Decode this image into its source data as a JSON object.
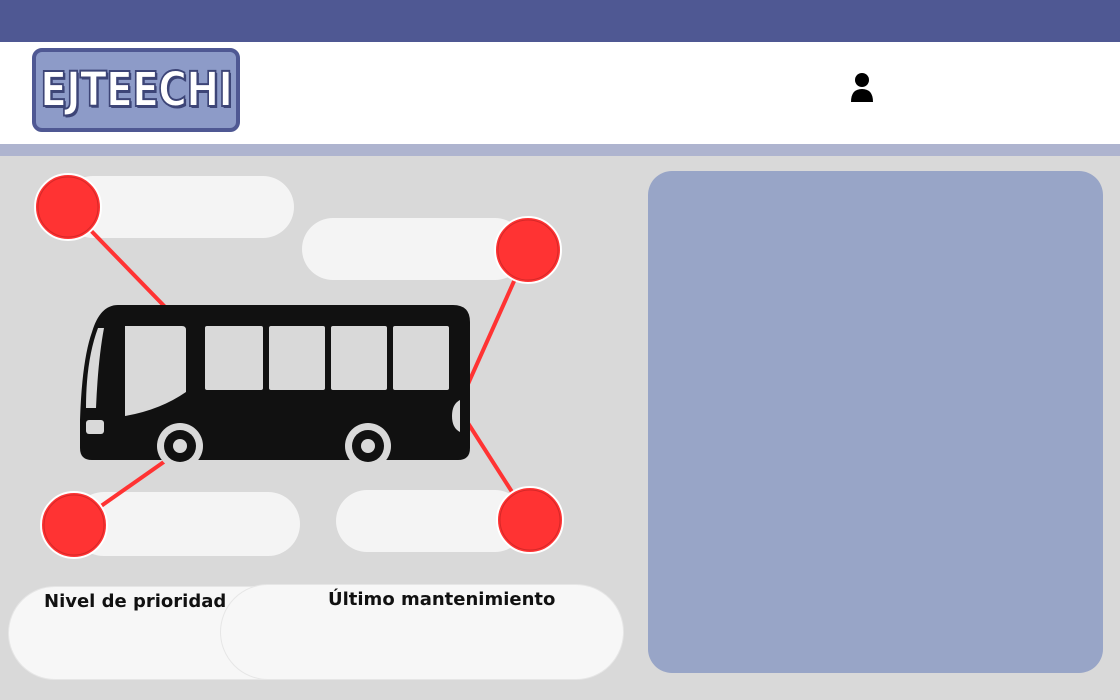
{
  "app": {
    "logo_text": "EJTEECHI",
    "user_icon": "user-icon"
  },
  "colors": {
    "top_bar": "#4f5893",
    "header_bg": "#ffffff",
    "sub_strip": "#aeb4cf",
    "page_bg": "#d9d9d9",
    "panel": "#98a5c7",
    "marker": "#ff3333",
    "bus": "#111111"
  },
  "diagram": {
    "bus_icon": "bus-icon",
    "marker_count": 4
  },
  "fields": {
    "priority_label": "Nivel de prioridad",
    "maintenance_label": "Último mantenimiento"
  }
}
